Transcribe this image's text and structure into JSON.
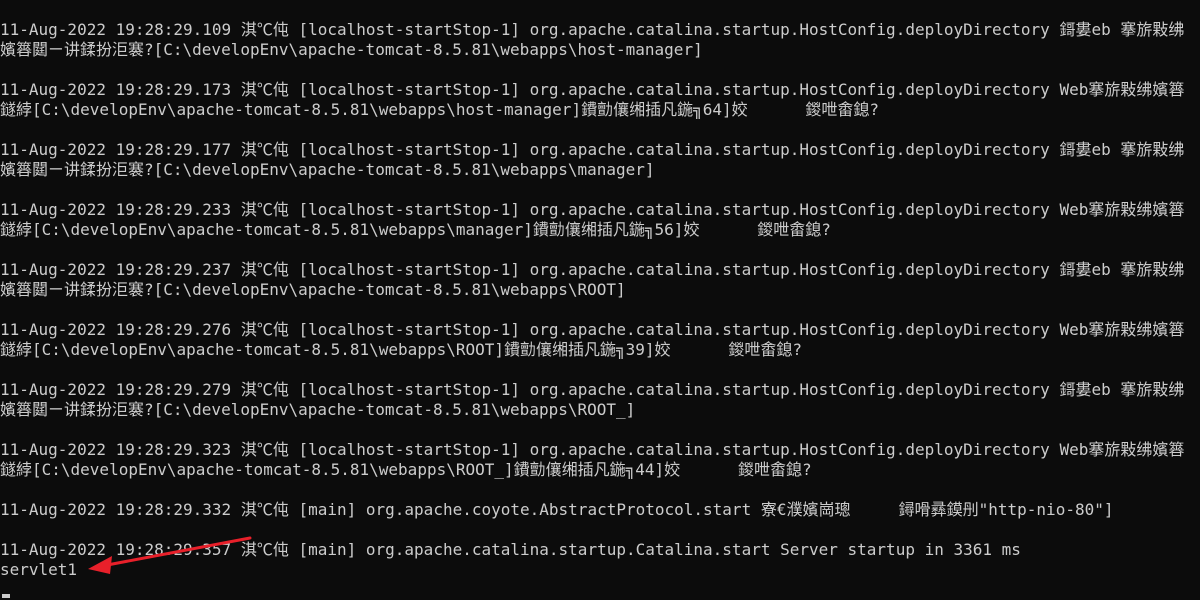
{
  "console": {
    "lines": [
      "11-Aug-2022 19:28:29.109 淇℃伅 [localhost-startStop-1] org.apache.catalina.startup.HostConfig.deployDirectory 鎶婁eb 搴旂敤绋嬪簭閮ㄧ讲鍒扮洰褰?[C:\\developEnv\\apache-tomcat-8.5.81\\webapps\\host-manager]",
      "",
      "11-Aug-2022 19:28:29.173 淇℃伅 [localhost-startStop-1] org.apache.catalina.startup.HostConfig.deployDirectory Web搴旂敤绋嬪簭鐩綍[C:\\developEnv\\apache-tomcat-8.5.81\\webapps\\host-manager]鐨勯儴缃插凡鍦╗64]姣      鍐呭畬鎴?",
      "",
      "11-Aug-2022 19:28:29.177 淇℃伅 [localhost-startStop-1] org.apache.catalina.startup.HostConfig.deployDirectory 鎶婁eb 搴旂敤绋嬪簭閮ㄧ讲鍒扮洰褰?[C:\\developEnv\\apache-tomcat-8.5.81\\webapps\\manager]",
      "",
      "11-Aug-2022 19:28:29.233 淇℃伅 [localhost-startStop-1] org.apache.catalina.startup.HostConfig.deployDirectory Web搴旂敤绋嬪簭鐩綍[C:\\developEnv\\apache-tomcat-8.5.81\\webapps\\manager]鐨勯儴缃插凡鍦╗56]姣      鍐呭畬鎴?",
      "",
      "11-Aug-2022 19:28:29.237 淇℃伅 [localhost-startStop-1] org.apache.catalina.startup.HostConfig.deployDirectory 鎶婁eb 搴旂敤绋嬪簭閮ㄧ讲鍒扮洰褰?[C:\\developEnv\\apache-tomcat-8.5.81\\webapps\\ROOT]",
      "",
      "11-Aug-2022 19:28:29.276 淇℃伅 [localhost-startStop-1] org.apache.catalina.startup.HostConfig.deployDirectory Web搴旂敤绋嬪簭鐩綍[C:\\developEnv\\apache-tomcat-8.5.81\\webapps\\ROOT]鐨勯儴缃插凡鍦╗39]姣      鍐呭畬鎴?",
      "",
      "11-Aug-2022 19:28:29.279 淇℃伅 [localhost-startStop-1] org.apache.catalina.startup.HostConfig.deployDirectory 鎶婁eb 搴旂敤绋嬪簭閮ㄧ讲鍒扮洰褰?[C:\\developEnv\\apache-tomcat-8.5.81\\webapps\\ROOT_]",
      "",
      "11-Aug-2022 19:28:29.323 淇℃伅 [localhost-startStop-1] org.apache.catalina.startup.HostConfig.deployDirectory Web搴旂敤绋嬪簭鐩綍[C:\\developEnv\\apache-tomcat-8.5.81\\webapps\\ROOT_]鐨勯儴缃插凡鍦╗44]姣      鍐呭畬鎴?",
      "",
      "11-Aug-2022 19:28:29.332 淇℃伅 [main] org.apache.coyote.AbstractProtocol.start 寮€濮嬪崗璁     鐞嗗彞鏌刐\"http-nio-80\"]",
      "",
      "11-Aug-2022 19:28:29.357 淇℃伅 [main] org.apache.catalina.startup.Catalina.start Server startup in 3361 ms",
      "servlet1"
    ]
  },
  "annotation": {
    "arrow_color": "#e8202a"
  },
  "colors": {
    "background": "#0c0c0c",
    "text": "#cccccc"
  }
}
